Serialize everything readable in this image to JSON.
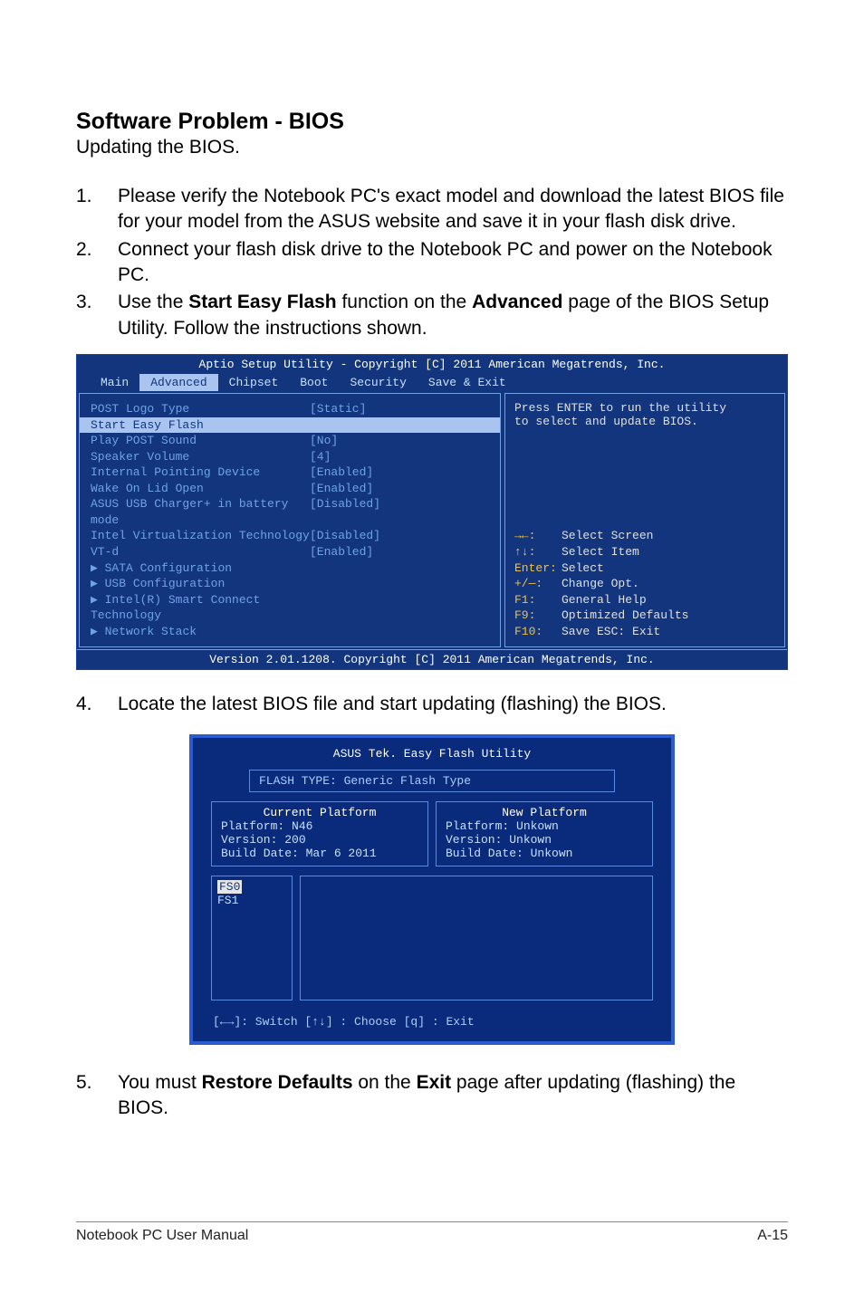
{
  "headings": {
    "title": "Software Problem - BIOS",
    "subtitle": "Updating the BIOS."
  },
  "steps": {
    "s1_num": "1.",
    "s1": "Please verify the Notebook PC's exact model and download the latest BIOS file for your model from the ASUS website and save it in your flash disk drive.",
    "s2_num": "2.",
    "s2": "Connect your flash disk drive to the Notebook PC and power on the Notebook PC.",
    "s3_num": "3.",
    "s3a": "Use the ",
    "s3b": "Start Easy Flash",
    "s3c": " function on the ",
    "s3d": "Advanced",
    "s3e": " page of the BIOS Setup Utility. Follow the instructions shown.",
    "s4_num": "4.",
    "s4": "Locate the latest BIOS file and start updating (flashing) the BIOS.",
    "s5_num": "5.",
    "s5a": "You must ",
    "s5b": "Restore Defaults",
    "s5c": " on the ",
    "s5d": "Exit",
    "s5e": " page after updating (flashing) the BIOS."
  },
  "bios": {
    "header": "Aptio Setup Utility - Copyright [C] 2011 American Megatrends, Inc.",
    "tabs": {
      "main": "Main",
      "advanced": "Advanced",
      "chipset": "Chipset",
      "boot": "Boot",
      "security": "Security",
      "save": "Save & Exit"
    },
    "rows": [
      {
        "label": "POST Logo Type",
        "val": "[Static]",
        "cls": "blue"
      },
      {
        "label": "Start Easy Flash",
        "val": "",
        "cls": "hl"
      },
      {
        "label": "Play POST Sound",
        "val": "[No]",
        "cls": "blue"
      },
      {
        "label": "Speaker Volume",
        "val": "[4]",
        "cls": "blue"
      },
      {
        "label": "Internal Pointing Device",
        "val": "[Enabled]",
        "cls": "blue"
      },
      {
        "label": "Wake On Lid Open",
        "val": "[Enabled]",
        "cls": "blue"
      },
      {
        "label": "ASUS USB Charger+ in battery mode",
        "val": "[Disabled]",
        "cls": "blue"
      },
      {
        "label": "",
        "val": "",
        "cls": "blue"
      },
      {
        "label": "Intel Virtualization Technology",
        "val": "[Disabled]",
        "cls": "blue"
      },
      {
        "label": "  VT-d",
        "val": "[Enabled]",
        "cls": "blue"
      },
      {
        "label": "▶ SATA Configuration",
        "val": "",
        "cls": "blue"
      },
      {
        "label": "▶ USB Configuration",
        "val": "",
        "cls": "blue"
      },
      {
        "label": "▶ Intel(R) Smart Connect Technology",
        "val": "",
        "cls": "blue"
      },
      {
        "label": "▶ Network Stack",
        "val": "",
        "cls": "blue"
      }
    ],
    "help": {
      "l1": "Press ENTER to run the utility",
      "l2": "to select and update BIOS."
    },
    "hints": {
      "h1k": "→←:",
      "h1v": "Select Screen",
      "h2k": "↑↓:",
      "h2v": "Select Item",
      "h3k": "Enter:",
      "h3v": "Select",
      "h4k": "+/—:",
      "h4v": "Change Opt.",
      "h5k": "F1:",
      "h5v": "General Help",
      "h6k": "F9:",
      "h6v": "Optimized Defaults",
      "h7k": "F10:",
      "h7v": "Save   ESC: Exit"
    },
    "footer": "Version 2.01.1208. Copyright [C] 2011 American Megatrends, Inc."
  },
  "flash": {
    "title": "ASUS Tek. Easy Flash Utility",
    "type": "FLASH TYPE: Generic Flash Type",
    "cur_head": "Current Platform",
    "cur_plat": "Platform:  N46",
    "cur_ver": "Version:   200",
    "cur_date": "Build Date: Mar 6 2011",
    "new_head": "New Platform",
    "new_plat": "Platform:  Unkown",
    "new_ver": "Version:   Unkown",
    "new_date": "Build Date: Unkown",
    "fs0": "FS0",
    "fs1": "FS1",
    "hints": "[←→]: Switch   [↑↓] : Choose   [q] : Exit"
  },
  "footer": {
    "left": "Notebook PC User Manual",
    "right": "A-15"
  }
}
